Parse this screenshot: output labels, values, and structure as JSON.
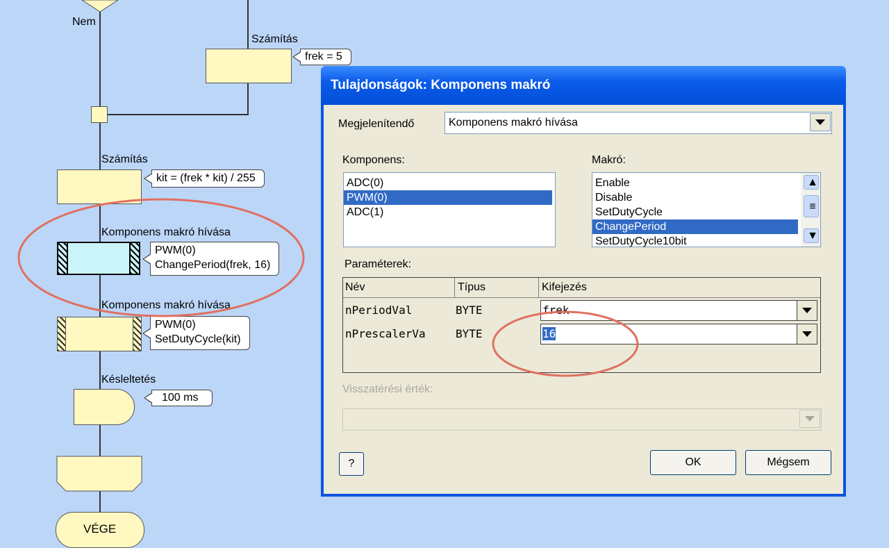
{
  "flowchart": {
    "no_label": "Nem",
    "calc1": {
      "title": "Számítás",
      "note": "frek = 5"
    },
    "calc2": {
      "title": "Számítás",
      "note": "kit = (frek * kit) / 255"
    },
    "macro1": {
      "title": "Komponens makró hívása",
      "line1": "PWM(0)",
      "line2": "ChangePeriod(frek, 16)"
    },
    "macro2": {
      "title": "Komponens makró hívása",
      "line1": "PWM(0)",
      "line2": "SetDutyCycle(kit)"
    },
    "delay": {
      "title": "Késleltetés",
      "note": "100 ms"
    },
    "end_label": "VÉGE"
  },
  "dialog": {
    "title": "Tulajdonságok: Komponens makró",
    "display_label": "Megjelenítendő",
    "display_value": "Komponens makró hívása",
    "component_label": "Komponens:",
    "components": [
      "ADC(0)",
      "PWM(0)",
      "ADC(1)"
    ],
    "selected_component": "PWM(0)",
    "macro_label": "Makró:",
    "macros": [
      "Enable",
      "Disable",
      "SetDutyCycle",
      "ChangePeriod",
      "SetDutyCycle10bit"
    ],
    "selected_macro": "ChangePeriod",
    "params_label": "Paraméterek:",
    "params_headers": [
      "Név",
      "Típus",
      "Kifejezés"
    ],
    "params": [
      {
        "name": "nPeriodVal",
        "type": "BYTE",
        "expr": "frek"
      },
      {
        "name": "nPrescalerVa",
        "type": "BYTE",
        "expr": "16"
      }
    ],
    "return_label": "Visszatérési érték:",
    "help_button": "?",
    "ok_button": "OK",
    "cancel_button": "Mégsem"
  },
  "annotation_color": "#e07060"
}
